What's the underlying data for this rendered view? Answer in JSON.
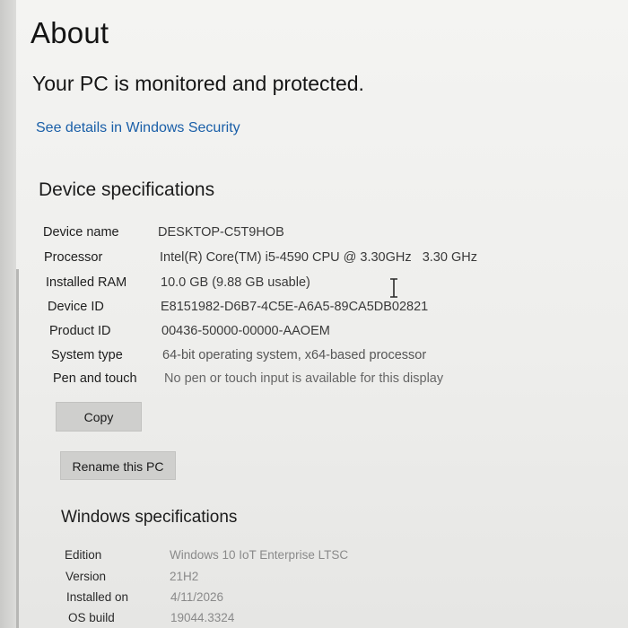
{
  "page": {
    "title": "About",
    "protection_status": "Your PC is monitored and protected.",
    "security_link": "See details in Windows Security"
  },
  "device_specs": {
    "heading": "Device specifications",
    "rows": [
      {
        "label": "Device name",
        "value": "DESKTOP-C5T9HOB"
      },
      {
        "label": "Processor",
        "value": "Intel(R) Core(TM) i5-4590 CPU @ 3.30GHz   3.30 GHz"
      },
      {
        "label": "Installed RAM",
        "value": "10.0 GB (9.88 GB usable)"
      },
      {
        "label": "Device ID",
        "value": "E8151982-D6B7-4C5E-A6A5-89CA5DB02821"
      },
      {
        "label": "Product ID",
        "value": "00436-50000-00000-AAOEM"
      },
      {
        "label": "System type",
        "value": "64-bit operating system, x64-based processor"
      },
      {
        "label": "Pen and touch",
        "value": "No pen or touch input is available for this display"
      }
    ],
    "copy_label": "Copy",
    "rename_label": "Rename this PC"
  },
  "windows_specs": {
    "heading": "Windows specifications",
    "rows": [
      {
        "label": "Edition",
        "value": "Windows 10 IoT Enterprise LTSC"
      },
      {
        "label": "Version",
        "value": "21H2"
      },
      {
        "label": "Installed on",
        "value": "4/11/2026"
      },
      {
        "label": "OS build",
        "value": "19044.3324"
      }
    ]
  },
  "icons": {
    "cursor": "text-cursor-icon"
  }
}
